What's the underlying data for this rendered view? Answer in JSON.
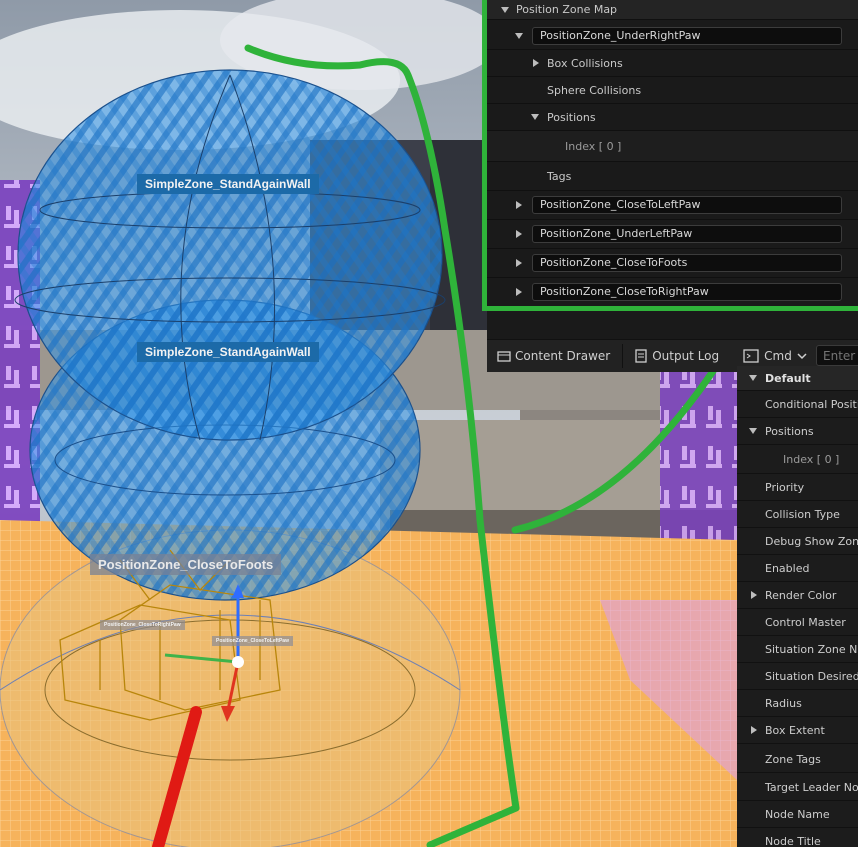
{
  "viewport": {
    "zone_labels": {
      "top": "SimpleZone_StandAgainWall",
      "middle": "SimpleZone_StandAgainWall",
      "bottom": "PositionZone_CloseToFoots",
      "small_left": "PositionZone_CloseToRightPaw",
      "small_right": "PositionZone_CloseToLeftPaw"
    }
  },
  "details": {
    "section_title": "Position Zone Map",
    "expanded_zone": "PositionZone_UnderRightPaw",
    "sub_items": {
      "box_collisions": "Box Collisions",
      "sphere_collisions": "Sphere Collisions",
      "positions": "Positions",
      "index_0": "Index [ 0 ]",
      "tags": "Tags"
    },
    "zones": [
      "PositionZone_CloseToLeftPaw",
      "PositionZone_UnderLeftPaw",
      "PositionZone_CloseToFoots",
      "PositionZone_CloseToRightPaw"
    ]
  },
  "bottom_bar": {
    "content_drawer": "Content Drawer",
    "output_log": "Output Log",
    "cmd": "Cmd",
    "cmd_placeholder": "Enter"
  },
  "properties": {
    "default_section": "Default",
    "conditional_position": "Conditional Positio",
    "positions": "Positions",
    "index_0": "Index [ 0 ]",
    "priority": "Priority",
    "collision_type": "Collision Type",
    "debug_show_zone": "Debug Show Zone",
    "enabled": "Enabled",
    "render_color": "Render Color",
    "control_master": "Control Master",
    "situation_zone_name": "Situation Zone Nar",
    "situation_desired": "Situation Desired Z",
    "radius": "Radius",
    "box_extent": "Box Extent",
    "zone_tags": "Zone Tags",
    "target_leader_node": "Target Leader Nod",
    "node_name": "Node Name",
    "node_title": "Node Title"
  },
  "colors": {
    "annotation": "#2fb33a",
    "sphere_blue": "#2a8fe0",
    "floor_orange": "#f5b55a"
  }
}
